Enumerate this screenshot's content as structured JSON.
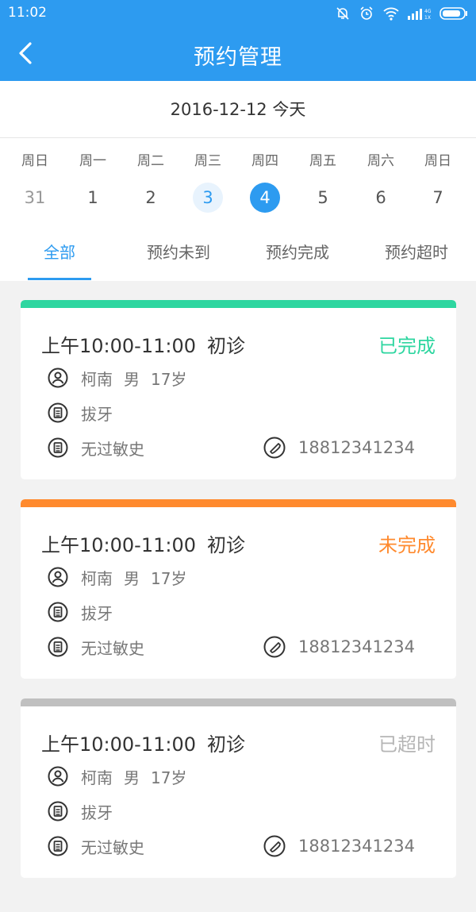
{
  "status_bar": {
    "time": "11:02"
  },
  "header": {
    "title": "预约管理"
  },
  "date_bar": {
    "date": "2016-12-12",
    "today_label": "今天"
  },
  "week": {
    "days": [
      {
        "weekday": "周日",
        "day": "31"
      },
      {
        "weekday": "周一",
        "day": "1"
      },
      {
        "weekday": "周二",
        "day": "2"
      },
      {
        "weekday": "周三",
        "day": "3"
      },
      {
        "weekday": "周四",
        "day": "4"
      },
      {
        "weekday": "周五",
        "day": "5"
      },
      {
        "weekday": "周六",
        "day": "6"
      },
      {
        "weekday": "周日",
        "day": "7"
      }
    ]
  },
  "tabs": [
    {
      "label": "全部"
    },
    {
      "label": "预约未到"
    },
    {
      "label": "预约完成"
    },
    {
      "label": "预约超时"
    }
  ],
  "colors": {
    "accent": "#2d9bf0",
    "done": "#2ed6a0",
    "pending": "#ff8a2e",
    "overdue": "#c0c0c0"
  },
  "appointments": [
    {
      "time": "上午10:00-11:00",
      "type": "初诊",
      "status": "已完成",
      "name": "柯南",
      "gender": "男",
      "age": "17岁",
      "treatment": "拔牙",
      "allergy": "无过敏史",
      "phone": "18812341234"
    },
    {
      "time": "上午10:00-11:00",
      "type": "初诊",
      "status": "未完成",
      "name": "柯南",
      "gender": "男",
      "age": "17岁",
      "treatment": "拔牙",
      "allergy": "无过敏史",
      "phone": "18812341234"
    },
    {
      "time": "上午10:00-11:00",
      "type": "初诊",
      "status": "已超时",
      "name": "柯南",
      "gender": "男",
      "age": "17岁",
      "treatment": "拔牙",
      "allergy": "无过敏史",
      "phone": "18812341234"
    }
  ]
}
